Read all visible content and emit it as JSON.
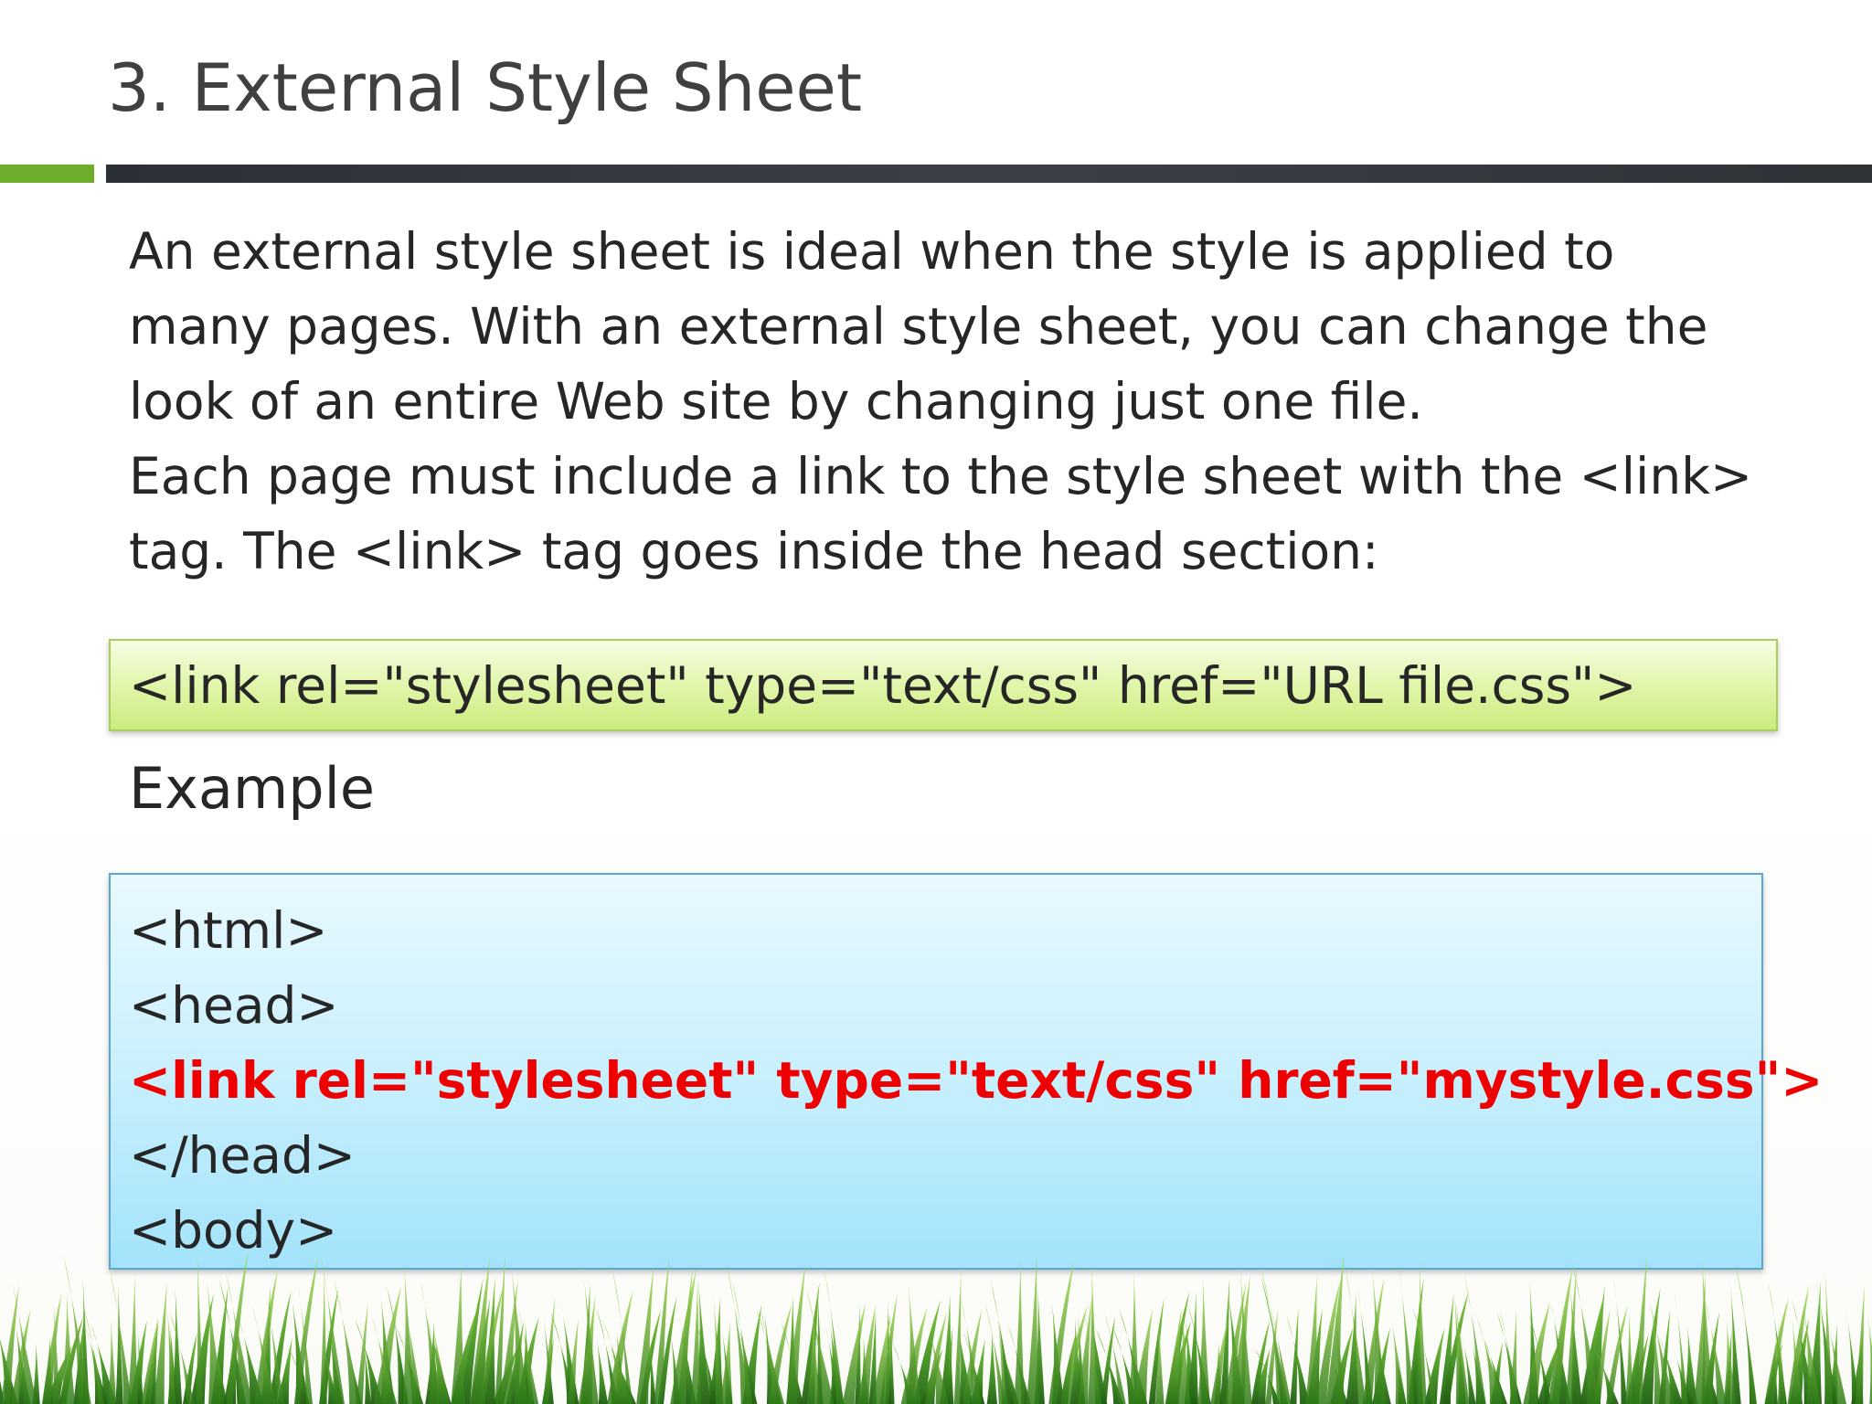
{
  "slide": {
    "title": "3. External Style Sheet",
    "body_lines": [
      "An external style sheet is ideal when the style is applied to",
      "many pages. With an external style sheet, you can change the",
      "look of an entire Web site by changing just one file.",
      "Each page must include a link to the style sheet with the <link>",
      "tag. The <link> tag goes inside the head section:"
    ],
    "syntax_code": "<link rel=\"stylesheet\" type=\"text/css\" href=\"URL file.css\">",
    "example_label": "Example",
    "example_lines": [
      "<html>",
      "<head>",
      "<link rel=\"stylesheet\" type=\"text/css\" href=\"mystyle.css\">",
      "</head>",
      "<body>"
    ]
  },
  "colors": {
    "accent_green": "#6cae2c",
    "accent_dark": "#2b3036",
    "highlight_red": "#ee0000",
    "syntax_box_bg": "#dff5a6",
    "example_box_bg": "#c9f0fd"
  }
}
